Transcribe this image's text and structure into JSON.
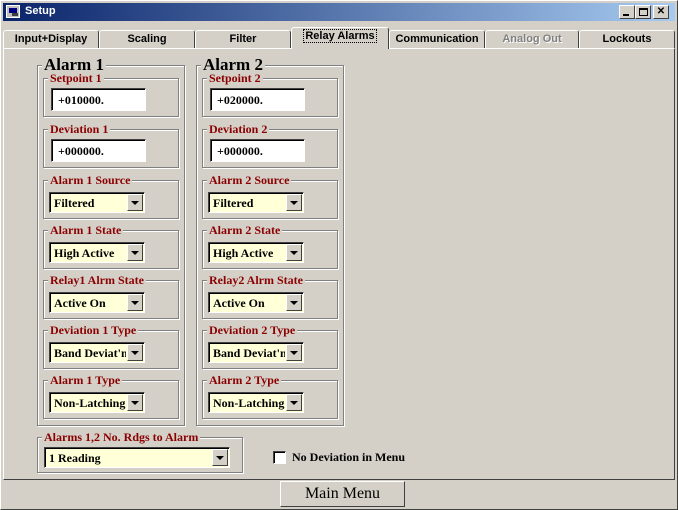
{
  "window": {
    "title": "Setup"
  },
  "tabs": [
    {
      "label": "Input+Display",
      "state": "normal"
    },
    {
      "label": "Scaling",
      "state": "normal"
    },
    {
      "label": "Filter",
      "state": "normal"
    },
    {
      "label": "Relay Alarms",
      "state": "active"
    },
    {
      "label": "Communication",
      "state": "normal"
    },
    {
      "label": "Analog Out",
      "state": "disabled"
    },
    {
      "label": "Lockouts",
      "state": "normal"
    }
  ],
  "alarm1": {
    "title": "Alarm 1",
    "setpoint_label": "Setpoint 1",
    "setpoint_value": "+010000.",
    "deviation_label": "Deviation 1",
    "deviation_value": "+000000.",
    "source_label": "Alarm 1 Source",
    "source_value": "Filtered",
    "state_label": "Alarm 1 State",
    "state_value": "High Active",
    "relay_label": "Relay1 Alrm State",
    "relay_value": "Active On",
    "devtype_label": "Deviation 1 Type",
    "devtype_value": "Band Deviat'n",
    "type_label": "Alarm 1 Type",
    "type_value": "Non-Latching"
  },
  "alarm2": {
    "title": "Alarm 2",
    "setpoint_label": "Setpoint 2",
    "setpoint_value": "+020000.",
    "deviation_label": "Deviation 2",
    "deviation_value": "+000000.",
    "source_label": "Alarm 2 Source",
    "source_value": "Filtered",
    "state_label": "Alarm 2 State",
    "state_value": "High Active",
    "relay_label": "Relay2 Alrm State",
    "relay_value": "Active On",
    "devtype_label": "Deviation 2 Type",
    "devtype_value": "Band Deviat'n",
    "type_label": "Alarm 2 Type",
    "type_value": "Non-Latching"
  },
  "readings": {
    "label": "Alarms 1,2  No. Rdgs to Alarm",
    "value": "1 Reading"
  },
  "no_deviation": {
    "label": "No Deviation in Menu",
    "checked": false
  },
  "main_menu": {
    "label": "Main Menu"
  },
  "colors": {
    "title_start": "#0a246a",
    "title_end": "#a6caf0",
    "group_label": "#8b0000",
    "combo_bg": "#ffffd8",
    "face": "#d4d0c8"
  }
}
